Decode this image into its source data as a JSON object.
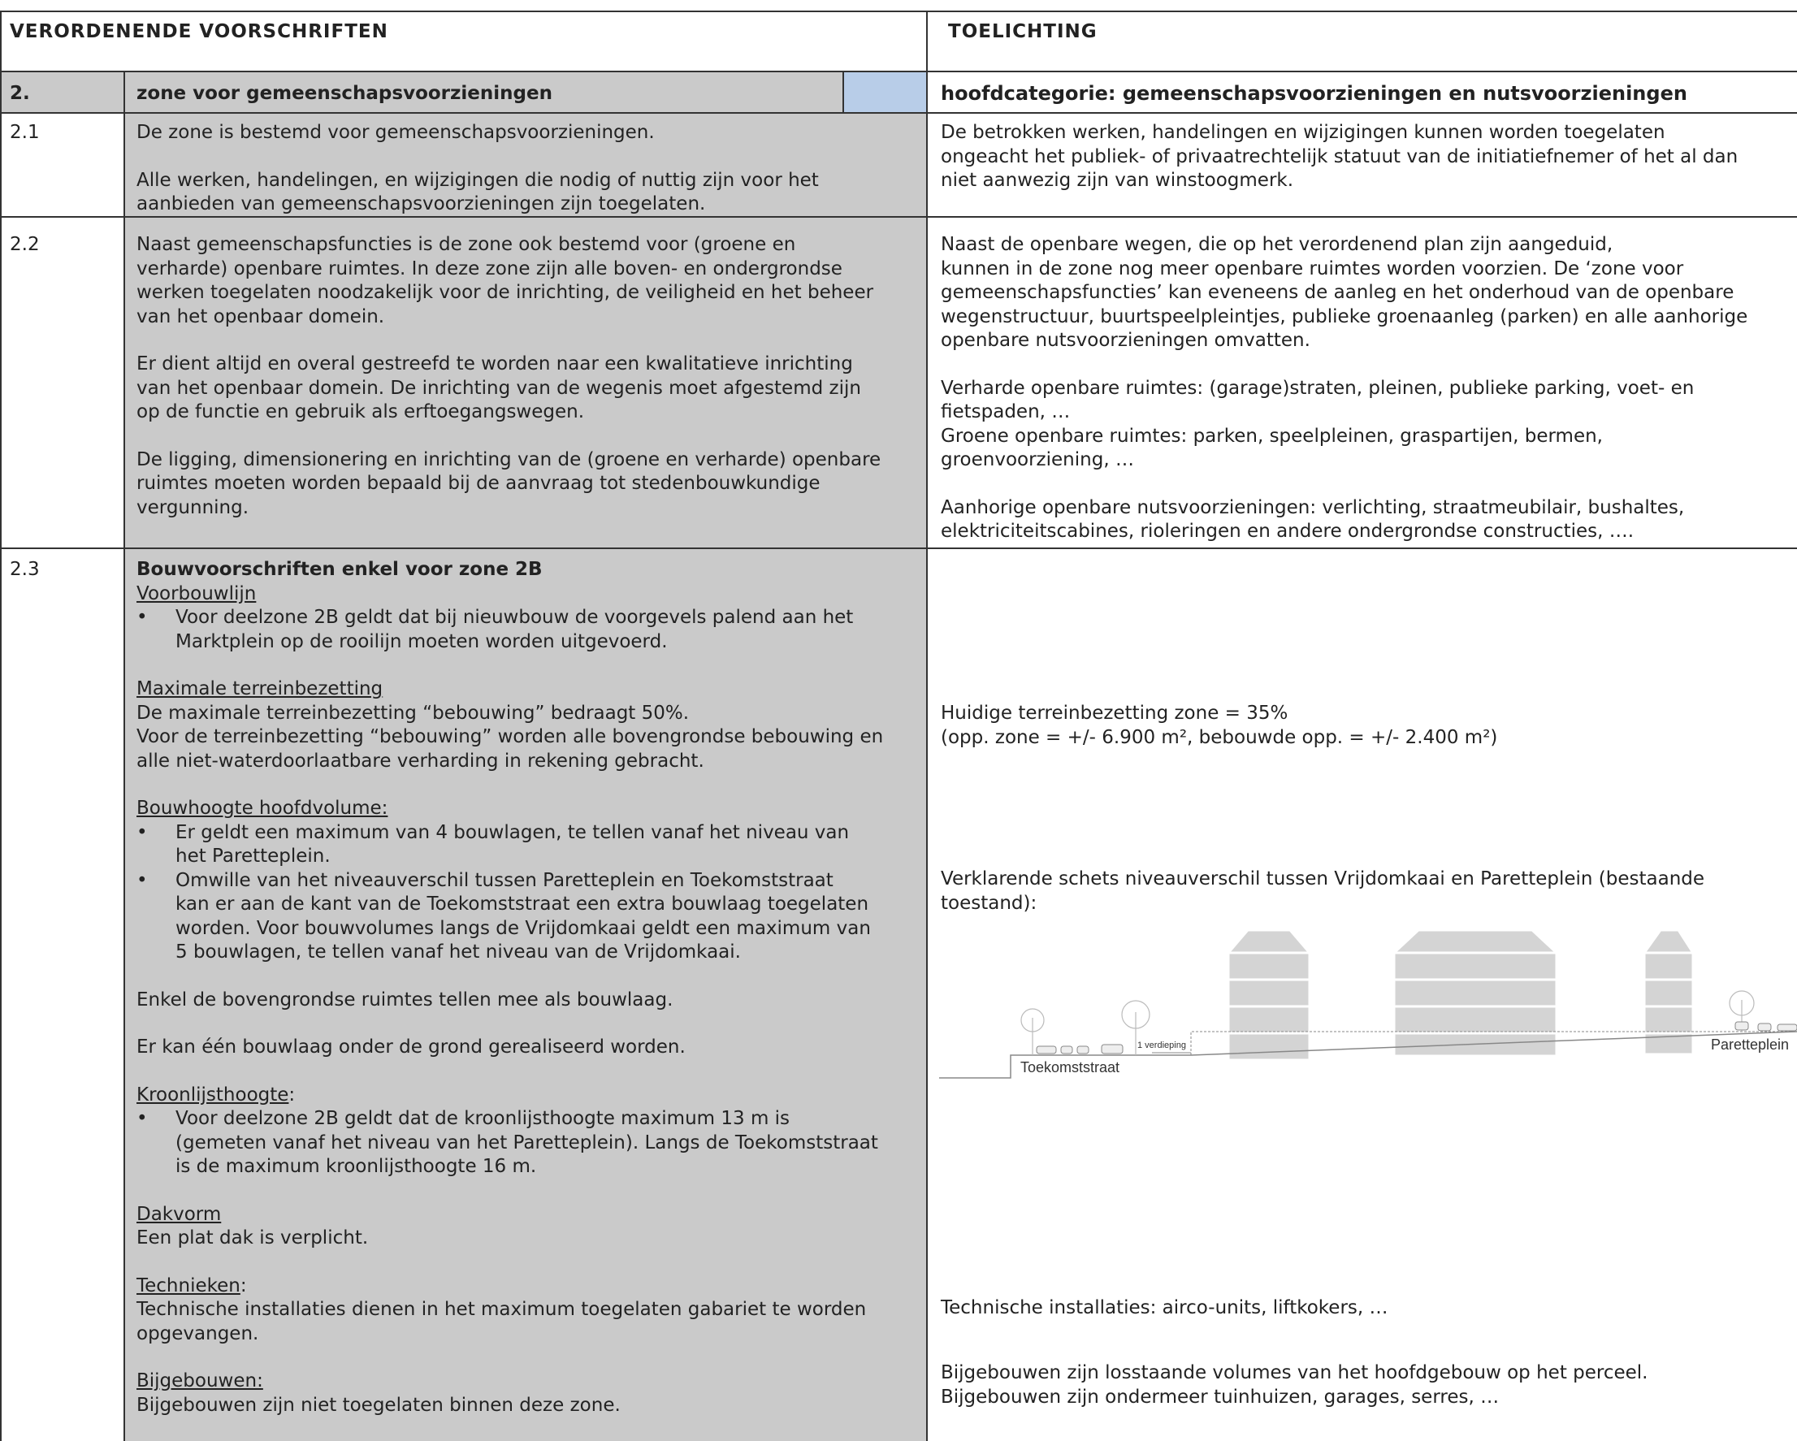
{
  "header": {
    "left": "VERORDENENDE VOORSCHRIFTEN",
    "right": "TOELICHTING"
  },
  "zone": {
    "number": "2.",
    "title": "zone voor gemeenschapsvoorzieningen",
    "category": "hoofdcategorie: gemeenschapsvoorzieningen en nutsvoorzieningen",
    "swatch_color": "#b8cde8"
  },
  "rows": {
    "r21": {
      "number": "2.1",
      "left": [
        "De zone is bestemd voor gemeenschapsvoorzieningen.",
        "Alle werken, handelingen, en wijzigingen die nodig of nuttig zijn voor het",
        "aanbieden van gemeenschapsvoorzieningen zijn toegelaten."
      ],
      "right": [
        "De betrokken werken, handelingen en wijzigingen kunnen worden toegelaten",
        "ongeacht het publiek- of privaatrechtelijk statuut van de initiatiefnemer of het al dan",
        "niet aanwezig zijn van winstoogmerk."
      ]
    },
    "r22": {
      "number": "2.2",
      "left_p1": [
        "Naast gemeenschapsfuncties is de zone ook bestemd voor (groene en",
        "verharde) openbare ruimtes. In deze zone zijn alle boven- en ondergrondse",
        "werken toegelaten noodzakelijk voor de inrichting, de veiligheid en het beheer",
        "van het openbaar domein."
      ],
      "left_p2": [
        "Er dient altijd en overal gestreefd te worden naar een kwalitatieve inrichting",
        "van het openbaar domein. De inrichting van de wegenis moet afgestemd zijn",
        "op de functie en gebruik als erftoegangswegen."
      ],
      "left_p3": [
        "De ligging, dimensionering en inrichting van de (groene en verharde) openbare",
        "ruimtes moeten worden bepaald bij de aanvraag tot stedenbouwkundige",
        "vergunning."
      ],
      "right_p1": [
        "Naast de openbare wegen, die op het verordenend plan zijn aangeduid,",
        "kunnen in de zone nog meer openbare ruimtes worden voorzien. De ‘zone voor",
        "gemeenschapsfuncties’ kan eveneens de aanleg en het onderhoud van de openbare",
        "wegenstructuur, buurtspeelpleintjes, publieke groenaanleg (parken) en alle aanhorige",
        "openbare nutsvoorzieningen omvatten."
      ],
      "right_p2": [
        "Verharde openbare ruimtes: (garage)straten, pleinen, publieke parking, voet- en",
        "fietspaden, …",
        "Groene openbare ruimtes: parken, speelpleinen, graspartijen, bermen,",
        "groenvoorziening, …"
      ],
      "right_p3": [
        "Aanhorige openbare nutsvoorzieningen: verlichting, straatmeubilair, bushaltes,",
        "elektriciteitscabines, rioleringen en andere ondergrondse constructies, …."
      ]
    },
    "r23": {
      "number": "2.3",
      "title": "Bouwvoorschriften enkel voor zone 2B",
      "voorbouwlijn_head": "Voorbouwlijn",
      "voorbouwlijn_bullet": [
        "Voor deelzone 2B geldt dat bij nieuwbouw de voorgevels palend aan het",
        "Marktplein op de rooilijn moeten worden uitgevoerd."
      ],
      "terrein_head": "Maximale terreinbezetting",
      "terrein_text": [
        "De maximale terreinbezetting “bebouwing” bedraagt 50%.",
        "Voor de terreinbezetting “bebouwing” worden alle bovengrondse bebouwing en",
        "alle niet-waterdoorlaatbare verharding in rekening gebracht."
      ],
      "hoogte_head": "Bouwhoogte hoofdvolume:",
      "hoogte_bullet1": [
        "Er geldt een maximum van 4 bouwlagen, te tellen vanaf het niveau van",
        "het Paretteplein."
      ],
      "hoogte_bullet2": [
        "Omwille van het niveauverschil tussen Paretteplein en Toekomststraat",
        "kan er aan de kant van de Toekomststraat een extra bouwlaag toegelaten",
        "worden. Voor bouwvolumes langs de Vrijdomkaai geldt een maximum van",
        "5 bouwlagen, te tellen vanaf het niveau van de Vrijdomkaai."
      ],
      "bovengronds": "Enkel de bovengrondse ruimtes tellen mee als bouwlaag.",
      "ondergrond": "Er kan één bouwlaag onder de grond gerealiseerd worden.",
      "kroon_head": "Kroonlijsthoogte",
      "kroon_colon": ":",
      "kroon_bullet": [
        "Voor deelzone 2B geldt dat de kroonlijsthoogte maximum 13 m is",
        "(gemeten vanaf het niveau van het Paretteplein). Langs de Toekomststraat",
        "is de maximum kroonlijsthoogte 16 m."
      ],
      "dak_head": "Dakvorm",
      "dak_text": "Een plat dak is verplicht.",
      "tech_head": "Technieken",
      "tech_colon": ":",
      "tech_text": [
        "Technische installaties dienen in het maximum toegelaten gabariet te worden",
        "opgevangen."
      ],
      "bij_head": "Bijgebouwen:",
      "bij_text": "Bijgebouwen zijn niet toegelaten binnen deze zone.",
      "right_terrein": [
        "Huidige terreinbezetting zone = 35%",
        "(opp. zone = +/- 6.900 m², bebouwde opp. = +/- 2.400 m²)"
      ],
      "right_schets": [
        "Verklarende schets niveauverschil tussen Vrijdomkaai en Paretteplein (bestaande",
        "toestand):"
      ],
      "right_tech": "Technische installaties: airco-units, liftkokers, …",
      "right_bij": [
        "Bijgebouwen zijn losstaande volumes van het hoofdgebouw op het perceel.",
        "Bijgebouwen zijn ondermeer tuinhuizen, garages, serres, …"
      ]
    }
  },
  "sketch": {
    "label_toekomststraat": "Toekomststraat",
    "label_paretteplein": "Paretteplein",
    "label_verdieping": "1 verdieping"
  }
}
